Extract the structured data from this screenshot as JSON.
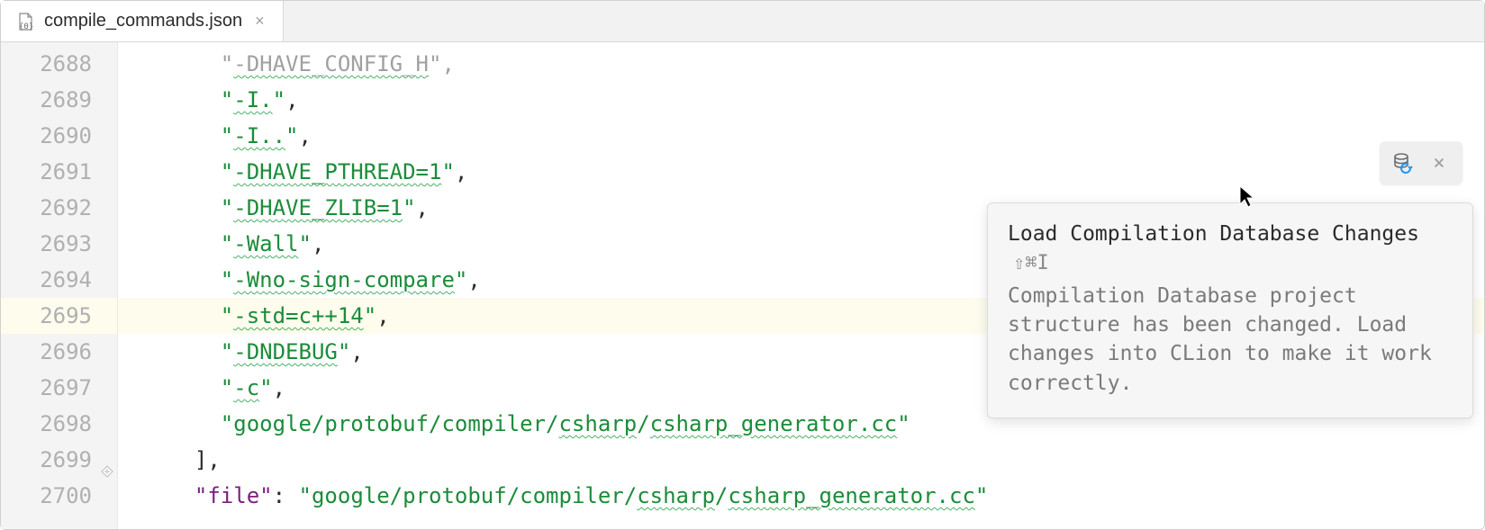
{
  "tab": {
    "filename": "compile_commands.json"
  },
  "gutter": {
    "start": 2688,
    "count": 13,
    "current": 2695
  },
  "lines": [
    {
      "n": 2688,
      "pre": "    ",
      "q1": "\"",
      "sq": "-DHAVE_CONFIG_H",
      "q2": "\"",
      "tail": ",",
      "cut": true
    },
    {
      "n": 2689,
      "pre": "    ",
      "q1": "\"",
      "sq": "-I.",
      "q2": "\"",
      "tail": ","
    },
    {
      "n": 2690,
      "pre": "    ",
      "q1": "\"",
      "sq": "-I..",
      "q2": "\"",
      "tail": ","
    },
    {
      "n": 2691,
      "pre": "    ",
      "q1": "\"",
      "sq": "-DHAVE_PTHREAD=1",
      "q2": "\"",
      "tail": ","
    },
    {
      "n": 2692,
      "pre": "    ",
      "q1": "\"",
      "sq": "-DHAVE_ZLIB=1",
      "q2": "\"",
      "tail": ","
    },
    {
      "n": 2693,
      "pre": "    ",
      "q1": "\"",
      "sq": "-Wall",
      "q2": "\"",
      "tail": ","
    },
    {
      "n": 2694,
      "pre": "    ",
      "q1": "\"",
      "sq": "-Wno-sign-compare",
      "q2": "\"",
      "tail": ","
    },
    {
      "n": 2695,
      "pre": "    ",
      "q1": "\"",
      "sq": "-std=c++14",
      "q2": "\"",
      "tail": ",",
      "current": true
    },
    {
      "n": 2696,
      "pre": "    ",
      "q1": "\"",
      "sq": "-DNDEBUG",
      "q2": "\"",
      "tail": ","
    },
    {
      "n": 2697,
      "pre": "    ",
      "q1": "\"",
      "sq": "-c",
      "q2": "\"",
      "tail": ","
    },
    {
      "n": 2698,
      "pre": "    ",
      "q1": "\"",
      "plain": "google/protobuf/compiler/",
      "sq": "csharp",
      "mid": "/",
      "sq2": "csharp_generator.cc",
      "q2": "\"",
      "tail": ""
    },
    {
      "n": 2699,
      "pre": "  ",
      "text": "],",
      "bracket": true
    },
    {
      "n": 2700,
      "pre": "  ",
      "key": "\"file\"",
      "colon": ": ",
      "q1": "\"",
      "plain": "google/protobuf/compiler/",
      "sq": "csharp",
      "mid": "/",
      "sq2": "csharp_generator.cc",
      "q2": "\""
    }
  ],
  "popup": {
    "title": "Load Compilation Database Changes",
    "shortcut": "⇧⌘I",
    "body": "Compilation Database project structure has been changed. Load changes into CLion to make it work correctly."
  }
}
